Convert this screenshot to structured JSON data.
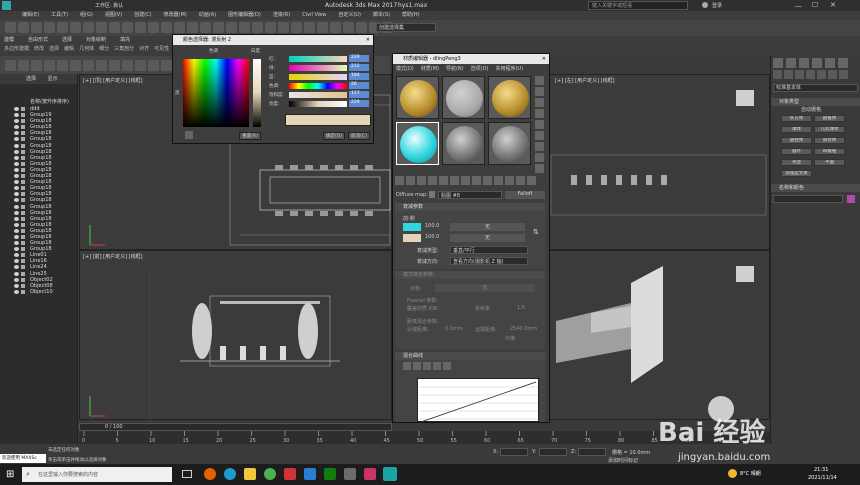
{
  "app": {
    "title": "Autodesk 3ds Max 2017",
    "file": "hys1.max",
    "workspace": "工作区: 默认",
    "search_placeholder": "键入关键字或短语",
    "user": "登录",
    "menu": [
      "编辑(E)",
      "工具(T)",
      "组(G)",
      "视图(V)",
      "创建(C)",
      "修改器(M)",
      "动画(A)",
      "图形编辑器(D)",
      "渲染(R)",
      "Civil View",
      "自定义(U)",
      "脚本(S)",
      "帮助(H)"
    ],
    "ribbon_tabs": [
      "建模",
      "自由形式",
      "选择",
      "对象绘制",
      "填充"
    ],
    "ribbon_sub": [
      "多边形建模",
      "修改",
      "选择",
      "编辑",
      "几何体",
      "细分",
      "三角剖分",
      "对齐",
      "可见性"
    ],
    "selection_set": "创建选择集"
  },
  "scene_explorer": {
    "tabs": [
      "选择",
      "显示"
    ],
    "header": "名称(按升序排序)",
    "items": [
      "ddd",
      "Group19",
      "Group18",
      "Group18",
      "Group18",
      "Group18",
      "Group18",
      "Group18",
      "Group18",
      "Group18",
      "Group18",
      "Group18",
      "Group18",
      "Group18",
      "Group18",
      "Group18",
      "Group18",
      "Group18",
      "Group18",
      "Group18",
      "Group18",
      "Group18",
      "Group18",
      "Group18",
      "Line01",
      "Line16",
      "Line24",
      "Line25",
      "Object02",
      "Object08",
      "Object10"
    ]
  },
  "viewports": {
    "top_left": "[+] [顶] [用户定义] [线框]",
    "bottom_left": "[+] [前] [用户定义] [线框]",
    "top_right": "[+] [左] [用户定义] [线框]"
  },
  "color_picker": {
    "title": "颜色选择器: 漫反射 2",
    "hue_label": "色调",
    "white_label": "白度",
    "black_label": "黑",
    "rows": [
      {
        "label": "红:",
        "value": "229"
      },
      {
        "label": "绿:",
        "value": "212"
      },
      {
        "label": "蓝:",
        "value": "184"
      },
      {
        "label": "色调:",
        "value": "26"
      },
      {
        "label": "饱和度:",
        "value": "117"
      },
      {
        "label": "亮度:",
        "value": "229"
      }
    ],
    "reset": "重置(R)",
    "ok": "确定(O)",
    "cancel": "取消(C)",
    "new_color": "#e5d4b8"
  },
  "material_editor": {
    "title": "材质编辑器 - dlingPeng3",
    "menu": [
      "模式(D)",
      "材质(M)",
      "导航(N)",
      "选项(O)",
      "实用程序(U)"
    ],
    "map_label": "Diffuse map:",
    "map_name": "贴图 #8",
    "map_type": "Falloff",
    "rollout_params": "衰减参数",
    "front_side": "前:侧",
    "slot1_value": "100.0",
    "slot2_value": "100.0",
    "none": "无",
    "falloff_type_label": "衰减类型:",
    "falloff_type": "垂直/平行",
    "falloff_dir_label": "衰减方向:",
    "falloff_dir": "查看方向(摄影机 Z 轴)",
    "mode_params": "模式特定参数:",
    "object_label": "对象:",
    "fresnel_label": "Fresnel 参数:",
    "override_ior": "覆盖材质 IOR",
    "ior_label": "折射率",
    "ior_value": "1.6",
    "distance_label": "距离混合参数:",
    "near_label": "近端距离:",
    "near_value": "0.0mm",
    "far_label": "远端距离:",
    "far_value": "2540.0mm",
    "extrapolate": "外推",
    "mix_curve": "混合曲线"
  },
  "command_panel": {
    "category": "标准基本体",
    "object_type": "对象类型",
    "auto_grid": "自动栅格",
    "buttons": [
      "长方体",
      "圆锥体",
      "球体",
      "几何球体",
      "圆柱体",
      "管状体",
      "圆环",
      "四棱锥",
      "茶壶",
      "平面",
      "加强型文本"
    ],
    "name_color": "名称和颜色"
  },
  "timeline": {
    "frame": "0 / 100",
    "ticks": [
      "0",
      "5",
      "10",
      "15",
      "20",
      "25",
      "30",
      "35",
      "40",
      "45",
      "50",
      "55",
      "60",
      "65",
      "70",
      "75",
      "80",
      "85",
      "90",
      "95",
      "100"
    ]
  },
  "status": {
    "welcome": "欢迎使用 MAXSc",
    "line1": "未选定任何对象",
    "line2": "单击或单击并拖动以选择对象",
    "x_label": "X:",
    "y_label": "Y:",
    "z_label": "Z:",
    "grid": "栅格 = 10.0mm",
    "add_time_tag": "添加时间标记"
  },
  "taskbar": {
    "search_placeholder": "在这里输入你要搜索的内容",
    "weather": "8°C 晴朗",
    "time": "21:31",
    "date": "2021/11/14"
  },
  "watermark": {
    "text": "Bai 经验",
    "url": "jingyan.baidu.com"
  }
}
